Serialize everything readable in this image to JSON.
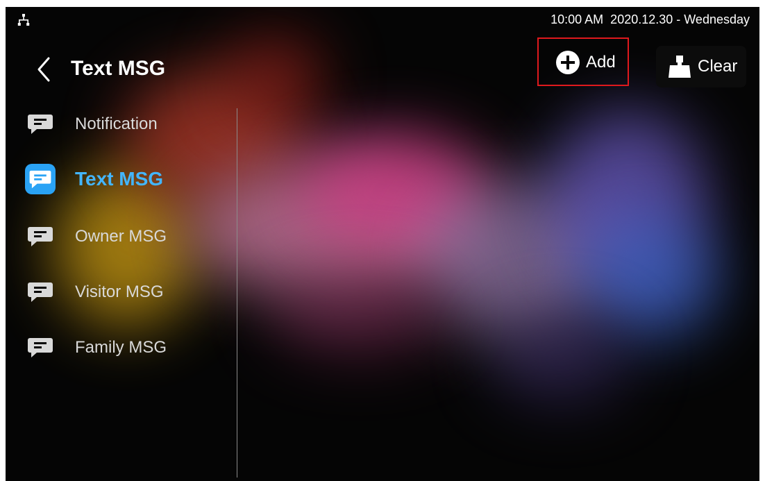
{
  "status_bar": {
    "network_icon": "network-tree-icon",
    "clock": "10:00 AM  2020.12.30 - Wednesday"
  },
  "header": {
    "back_icon": "chevron-left-icon",
    "title": "Text MSG",
    "add_label": "Add",
    "add_icon": "plus-circle-icon",
    "clear_label": "Clear",
    "clear_icon": "broom-icon"
  },
  "sidebar": {
    "items": [
      {
        "label": "Notification",
        "icon": "message-icon",
        "active": false
      },
      {
        "label": "Text MSG",
        "icon": "message-icon",
        "active": true
      },
      {
        "label": "Owner MSG",
        "icon": "message-icon",
        "active": false
      },
      {
        "label": "Visitor MSG",
        "icon": "message-icon",
        "active": false
      },
      {
        "label": "Family MSG",
        "icon": "message-icon",
        "active": false
      }
    ]
  },
  "colors": {
    "background": "#050505",
    "active_accent": "#43b6ff",
    "highlight_border": "#e0191d",
    "text": "#ffffff"
  }
}
